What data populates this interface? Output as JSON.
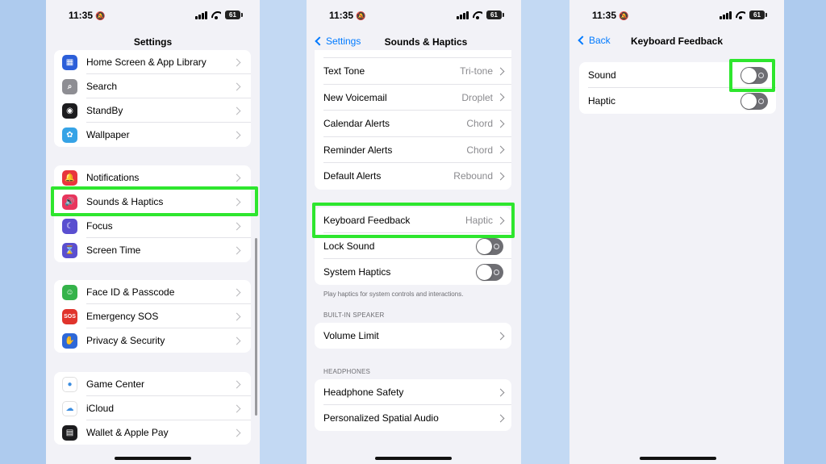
{
  "status": {
    "time": "11:35",
    "battery": "61"
  },
  "screen1": {
    "title": "Settings",
    "groups": [
      [
        {
          "label": "Home Screen & App Library",
          "icon": "home-screen-icon",
          "color": "#2c5fd9",
          "glyph": "▦"
        },
        {
          "label": "Search",
          "icon": "search-icon",
          "color": "#8e8e93",
          "glyph": "⌕"
        },
        {
          "label": "StandBy",
          "icon": "standby-icon",
          "color": "#1c1c1e",
          "glyph": "◉"
        },
        {
          "label": "Wallpaper",
          "icon": "wallpaper-icon",
          "color": "#36a3e6",
          "glyph": "✿"
        }
      ],
      [
        {
          "label": "Notifications",
          "icon": "notifications-icon",
          "color": "#e8363d",
          "glyph": "🔔"
        },
        {
          "label": "Sounds & Haptics",
          "icon": "sounds-icon",
          "color": "#e8365d",
          "glyph": "🔊"
        },
        {
          "label": "Focus",
          "icon": "focus-icon",
          "color": "#5a4fd0",
          "glyph": "☾"
        },
        {
          "label": "Screen Time",
          "icon": "screen-time-icon",
          "color": "#5a4fd0",
          "glyph": "⌛"
        }
      ],
      [
        {
          "label": "Face ID & Passcode",
          "icon": "face-id-icon",
          "color": "#35b34a",
          "glyph": "☺"
        },
        {
          "label": "Emergency SOS",
          "icon": "sos-icon",
          "color": "#e0342c",
          "glyph": "SOS"
        },
        {
          "label": "Privacy & Security",
          "icon": "privacy-hand-icon",
          "color": "#2e68d8",
          "glyph": "✋"
        }
      ],
      [
        {
          "label": "Game Center",
          "icon": "game-center-icon",
          "color": "#ffffff",
          "glyph": "●"
        },
        {
          "label": "iCloud",
          "icon": "icloud-icon",
          "color": "#ffffff",
          "glyph": "☁"
        },
        {
          "label": "Wallet & Apple Pay",
          "icon": "wallet-icon",
          "color": "#1c1c1e",
          "glyph": "▤"
        }
      ]
    ]
  },
  "screen2": {
    "back_label": "Settings",
    "title": "Sounds & Haptics",
    "tones": [
      {
        "label": "Text Tone",
        "value": "Tri-tone"
      },
      {
        "label": "New Voicemail",
        "value": "Droplet"
      },
      {
        "label": "Calendar Alerts",
        "value": "Chord"
      },
      {
        "label": "Reminder Alerts",
        "value": "Chord"
      },
      {
        "label": "Default Alerts",
        "value": "Rebound"
      }
    ],
    "feedback": {
      "label": "Keyboard Feedback",
      "value": "Haptic"
    },
    "lock_sound": "Lock Sound",
    "system_haptics": "System Haptics",
    "footnote": "Play haptics for system controls and interactions.",
    "speaker_header": "BUILT-IN SPEAKER",
    "volume_limit": "Volume Limit",
    "headphones_header": "HEADPHONES",
    "headphone_safety": "Headphone Safety",
    "spatial_audio": "Personalized Spatial Audio"
  },
  "screen3": {
    "back_label": "Back",
    "title": "Keyboard Feedback",
    "sound": "Sound",
    "haptic": "Haptic"
  },
  "colors": {
    "highlight": "#2ee62e",
    "accent": "#007aff",
    "background": "#aecbee"
  }
}
